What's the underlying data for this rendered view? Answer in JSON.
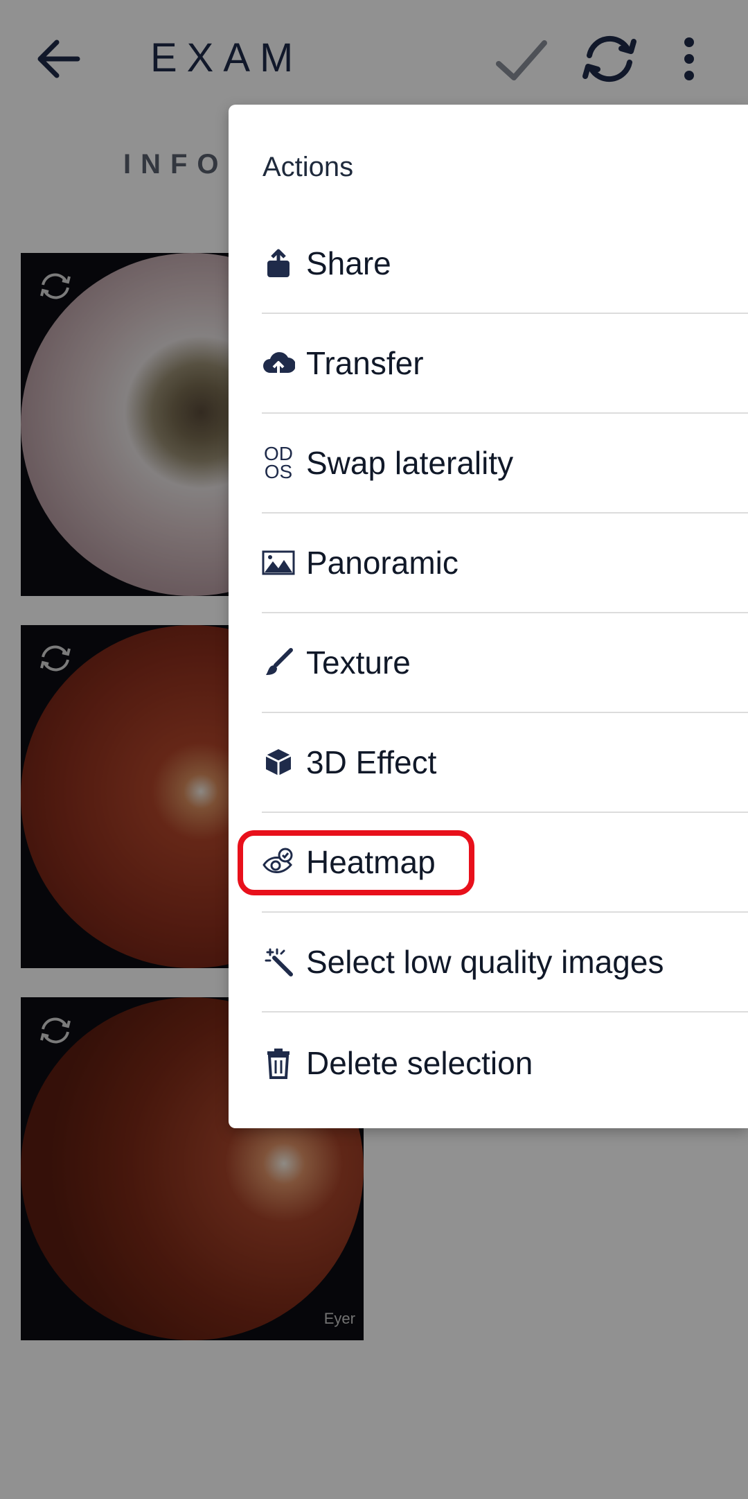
{
  "appbar": {
    "title": "EXAM",
    "icons": [
      "arrow-back-icon",
      "check-icon",
      "sync-icon",
      "more-vert-icon"
    ]
  },
  "tabs": {
    "info_label": "INFO"
  },
  "thumbnails": [
    {
      "kind": "external-eye",
      "icon": "rotate-icon"
    },
    {
      "kind": "fundus",
      "icon": "rotate-icon"
    },
    {
      "kind": "fundus",
      "icon": "rotate-icon",
      "watermark": "Eyer"
    }
  ],
  "menu": {
    "header": "Actions",
    "items": [
      {
        "label": "Share",
        "icon": "share-icon"
      },
      {
        "label": "Transfer",
        "icon": "cloud-upload-icon"
      },
      {
        "label": "Swap laterality",
        "icon": "od-os-icon",
        "icon_text_top": "OD",
        "icon_text_bottom": "OS"
      },
      {
        "label": "Panoramic",
        "icon": "panorama-icon"
      },
      {
        "label": "Texture",
        "icon": "brush-icon"
      },
      {
        "label": "3D Effect",
        "icon": "cube-icon"
      },
      {
        "label": "Heatmap",
        "icon": "eye-check-icon",
        "highlighted": true
      },
      {
        "label": "Select low quality images",
        "icon": "magic-wand-icon"
      },
      {
        "label": "Delete selection",
        "icon": "trash-icon"
      }
    ]
  },
  "colors": {
    "highlight": "#e8101b",
    "icon": "#1f2b4a",
    "scrim": "rgba(0,0,0,0.43)"
  }
}
